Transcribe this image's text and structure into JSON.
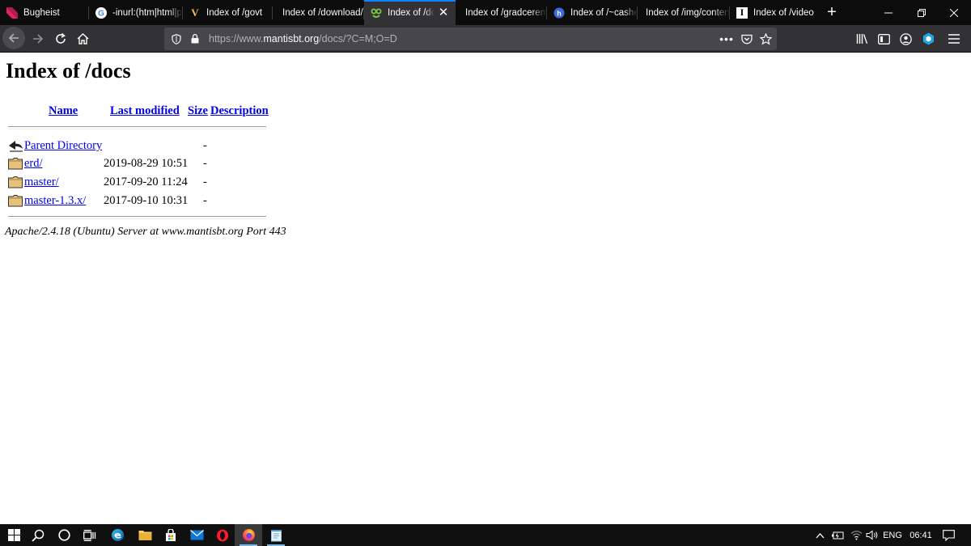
{
  "browser": {
    "tabs": [
      {
        "title": "Bugheist",
        "favicon": "bugheist-icon",
        "active": false
      },
      {
        "title": "-inurl:(htm|html|php",
        "favicon": "google-icon",
        "active": false
      },
      {
        "title": "Index of /govt",
        "favicon": "v-icon",
        "active": false
      },
      {
        "title": "Index of /download/",
        "favicon": "",
        "active": false
      },
      {
        "title": "Index of /docs",
        "favicon": "mantis-icon",
        "active": true
      },
      {
        "title": "Index of /gradceremony",
        "favicon": "",
        "active": false
      },
      {
        "title": "Index of /~cashe",
        "favicon": "h-circle-icon",
        "active": false
      },
      {
        "title": "Index of /img/content",
        "favicon": "",
        "active": false
      },
      {
        "title": "Index of /video",
        "favicon": "i-icon",
        "active": false
      }
    ],
    "url": {
      "prefix": "https://www.",
      "host": "mantisbt.org",
      "path": "/docs/?C=M;O=D"
    },
    "accent": "#0a84ff"
  },
  "page": {
    "title": "Index of /docs",
    "columns": {
      "name": "Name",
      "modified": "Last modified",
      "size": "Size",
      "description": "Description"
    },
    "rows": [
      {
        "icon": "back-icon",
        "name": "Parent Directory",
        "modified": "",
        "size": "-"
      },
      {
        "icon": "folder-icon",
        "name": "erd/",
        "modified": "2019-08-29 10:51",
        "size": "-"
      },
      {
        "icon": "folder-icon",
        "name": "master/",
        "modified": "2017-09-20 11:24",
        "size": "-"
      },
      {
        "icon": "folder-icon",
        "name": "master-1.3.x/",
        "modified": "2017-09-10 10:31",
        "size": "-"
      }
    ],
    "address": "Apache/2.4.18 (Ubuntu) Server at www.mantisbt.org Port 443"
  },
  "taskbar": {
    "language": "ENG",
    "time": "06:41"
  }
}
